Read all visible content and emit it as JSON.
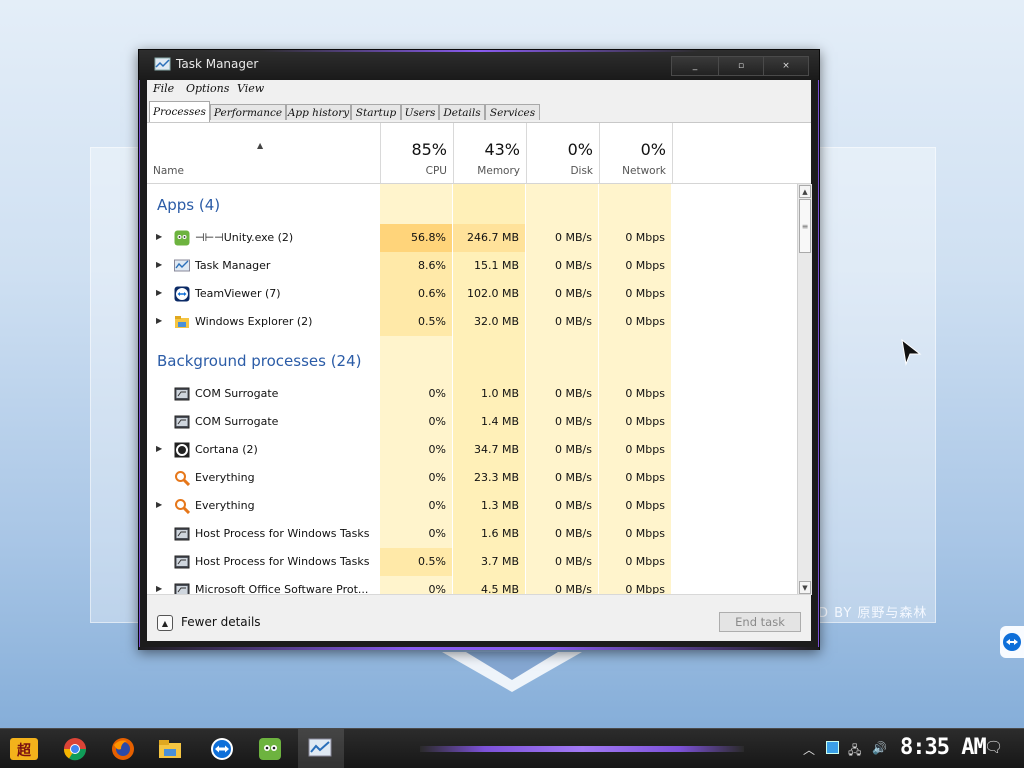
{
  "desktop": {
    "watermark": "D BY 原野与森林"
  },
  "window": {
    "title": "Task Manager",
    "controls": {
      "minimize": "_",
      "maximize": "▫",
      "close": "×"
    }
  },
  "menu": [
    "File",
    "Options",
    "View"
  ],
  "tabs": [
    {
      "label": "Processes",
      "active": true
    },
    {
      "label": "Performance",
      "active": false
    },
    {
      "label": "App history",
      "active": false
    },
    {
      "label": "Startup",
      "active": false
    },
    {
      "label": "Users",
      "active": false
    },
    {
      "label": "Details",
      "active": false
    },
    {
      "label": "Services",
      "active": false
    }
  ],
  "header": {
    "name_label": "Name",
    "columns": [
      {
        "percent": "85%",
        "label": "CPU"
      },
      {
        "percent": "43%",
        "label": "Memory"
      },
      {
        "percent": "0%",
        "label": "Disk"
      },
      {
        "percent": "0%",
        "label": "Network"
      }
    ]
  },
  "groups": [
    {
      "title": "Apps (4)",
      "rows": [
        {
          "name": "Unity.exe (2)",
          "prefix": "⊣⊢⊣",
          "expandable": true,
          "icon": "unity-icon",
          "cpu": "56.8%",
          "memory": "246.7 MB",
          "disk": "0 MB/s",
          "network": "0 Mbps"
        },
        {
          "name": "Task Manager",
          "expandable": true,
          "icon": "taskmanager-icon",
          "cpu": "8.6%",
          "memory": "15.1 MB",
          "disk": "0 MB/s",
          "network": "0 Mbps"
        },
        {
          "name": "TeamViewer (7)",
          "expandable": true,
          "icon": "teamviewer-icon",
          "cpu": "0.6%",
          "memory": "102.0 MB",
          "disk": "0 MB/s",
          "network": "0 Mbps"
        },
        {
          "name": "Windows Explorer (2)",
          "expandable": true,
          "icon": "explorer-icon",
          "cpu": "0.5%",
          "memory": "32.0 MB",
          "disk": "0 MB/s",
          "network": "0 Mbps"
        }
      ]
    },
    {
      "title": "Background processes (24)",
      "rows": [
        {
          "name": "COM Surrogate",
          "expandable": false,
          "icon": "process-icon",
          "cpu": "0%",
          "memory": "1.0 MB",
          "disk": "0 MB/s",
          "network": "0 Mbps"
        },
        {
          "name": "COM Surrogate",
          "expandable": false,
          "icon": "process-icon",
          "cpu": "0%",
          "memory": "1.4 MB",
          "disk": "0 MB/s",
          "network": "0 Mbps"
        },
        {
          "name": "Cortana (2)",
          "expandable": true,
          "icon": "cortana-icon",
          "cpu": "0%",
          "memory": "34.7 MB",
          "disk": "0 MB/s",
          "network": "0 Mbps"
        },
        {
          "name": "Everything",
          "expandable": false,
          "icon": "everything-icon",
          "cpu": "0%",
          "memory": "23.3 MB",
          "disk": "0 MB/s",
          "network": "0 Mbps"
        },
        {
          "name": "Everything",
          "expandable": true,
          "icon": "everything-icon",
          "cpu": "0%",
          "memory": "1.3 MB",
          "disk": "0 MB/s",
          "network": "0 Mbps"
        },
        {
          "name": "Host Process for Windows Tasks",
          "expandable": false,
          "icon": "process-icon",
          "cpu": "0%",
          "memory": "1.6 MB",
          "disk": "0 MB/s",
          "network": "0 Mbps"
        },
        {
          "name": "Host Process for Windows Tasks",
          "expandable": false,
          "icon": "process-icon",
          "cpu": "0.5%",
          "memory": "3.7 MB",
          "disk": "0 MB/s",
          "network": "0 Mbps"
        },
        {
          "name": "Microsoft Office Software Prot...",
          "expandable": true,
          "icon": "process-icon",
          "cpu": "0%",
          "memory": "4.5 MB",
          "disk": "0 MB/s",
          "network": "0 Mbps"
        }
      ]
    }
  ],
  "footer": {
    "fewer_details": "Fewer details",
    "end_task": "End task"
  },
  "taskbar": {
    "apps": [
      "start-icon",
      "chrome-icon",
      "firefox-icon",
      "file-explorer-icon",
      "teamviewer-icon",
      "unity-icon",
      "taskmanager-icon"
    ],
    "clock": "8:35 AM"
  }
}
